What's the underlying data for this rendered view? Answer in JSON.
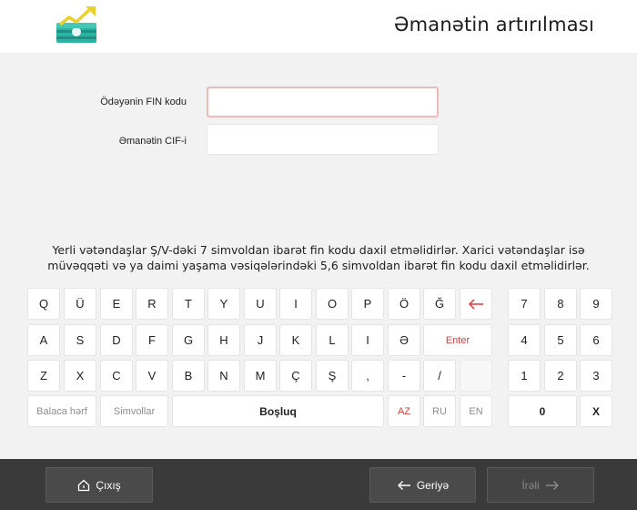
{
  "header": {
    "title": "Əmanətin artırılması"
  },
  "form": {
    "fin_label": "Ödəyənin FIN kodu",
    "fin_value": "",
    "cif_label": "Əmanətin CIF-i",
    "cif_value": ""
  },
  "hint": {
    "line1": "Yerli vətəndaşlar Ş/V-dəki 7 simvoldan ibarət fin kodu daxil etməlidirlər. Xarici vətəndaşlar isə",
    "line2": "müvəqqəti və ya daimi yaşama vəsiqələrindəki 5,6 simvoldan ibarət fin kodu daxil etməlidirlər."
  },
  "keyboard": {
    "row1": [
      "Q",
      "Ü",
      "E",
      "R",
      "T",
      "Y",
      "U",
      "I",
      "O",
      "P",
      "Ö",
      "Ğ"
    ],
    "row2": [
      "A",
      "S",
      "D",
      "F",
      "G",
      "H",
      "J",
      "K",
      "L",
      "I",
      "Ə"
    ],
    "row3": [
      "Z",
      "X",
      "C",
      "V",
      "B",
      "N",
      "M",
      "Ç",
      "Ş",
      ",",
      "-",
      "/"
    ],
    "enter": "Enter",
    "small_letters": "Balaca hərf",
    "symbols": "Simvollar",
    "space": "Boşluq",
    "lang_az": "AZ",
    "lang_ru": "RU",
    "lang_en": "EN",
    "numpad": [
      "7",
      "8",
      "9",
      "4",
      "5",
      "6",
      "1",
      "2",
      "3"
    ],
    "zero": "0",
    "clear": "X"
  },
  "footer": {
    "exit": "Çıxış",
    "back": "Geriyə",
    "next": "İrəli"
  },
  "colors": {
    "accent_red": "#e03a3a",
    "footer_bg": "#3a3a3a",
    "input_focus_border": "#f1b8b8"
  }
}
